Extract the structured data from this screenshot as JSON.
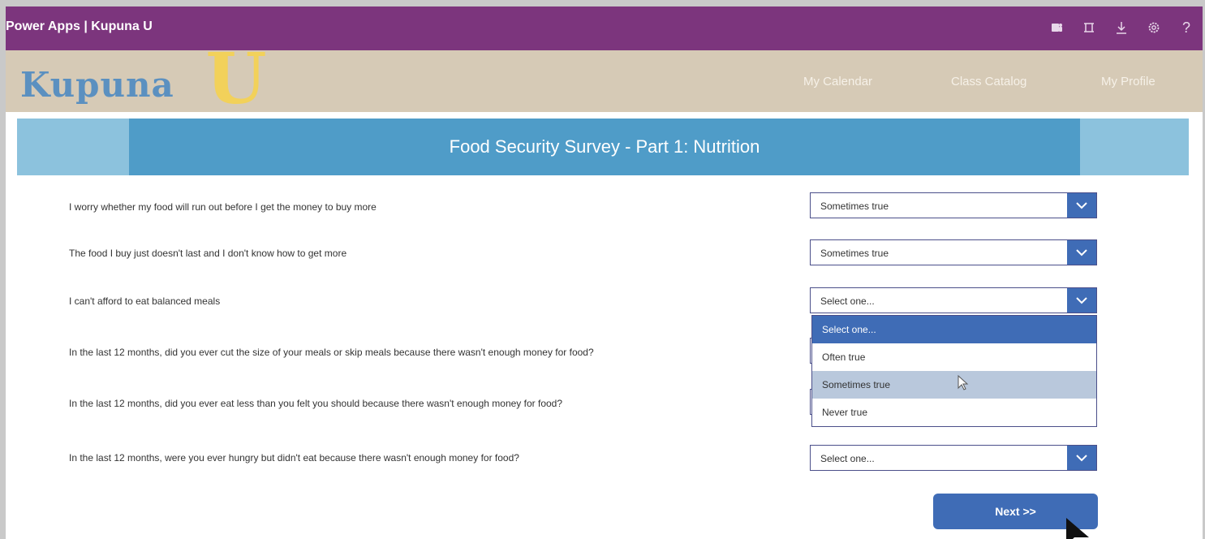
{
  "app": {
    "title": "Power Apps  |  Kupuna U"
  },
  "topbar_icons": [
    "teams-icon",
    "fit-screen-icon",
    "download-icon",
    "settings-icon",
    "help-icon"
  ],
  "logo": {
    "word": "Kupuna",
    "letter": "U"
  },
  "nav": {
    "calendar": "My Calendar",
    "catalog": "Class Catalog",
    "profile": "My Profile"
  },
  "banner": {
    "title": "Food Security Survey - Part 1: Nutrition"
  },
  "questions": [
    {
      "text": "I worry whether my food will run out before I get the money to buy more",
      "answer": "Sometimes true"
    },
    {
      "text": "The food I buy just doesn't last and I don't know how to get more",
      "answer": "Sometimes true"
    },
    {
      "text": "I can't afford to eat balanced meals",
      "answer": "Select one..."
    },
    {
      "text": "In the last 12 months, did you ever cut the size of your meals or skip meals because there wasn't enough money for food?",
      "answer": ""
    },
    {
      "text": "In the last 12 months, did you ever eat less than you felt you should because there wasn't enough money for food?",
      "answer": ""
    },
    {
      "text": "In the last 12 months, were you ever hungry but didn't eat because there wasn't enough money for food?",
      "answer": "Select one..."
    }
  ],
  "dropdown_options": [
    "Select one...",
    "Often true",
    "Sometimes true",
    "Never true"
  ],
  "next_button": "Next >>",
  "colors": {
    "topbar": "#7c357d",
    "header": "#d6cab6",
    "accent": "#3f6cb6",
    "banner": "#4f9cc8"
  }
}
